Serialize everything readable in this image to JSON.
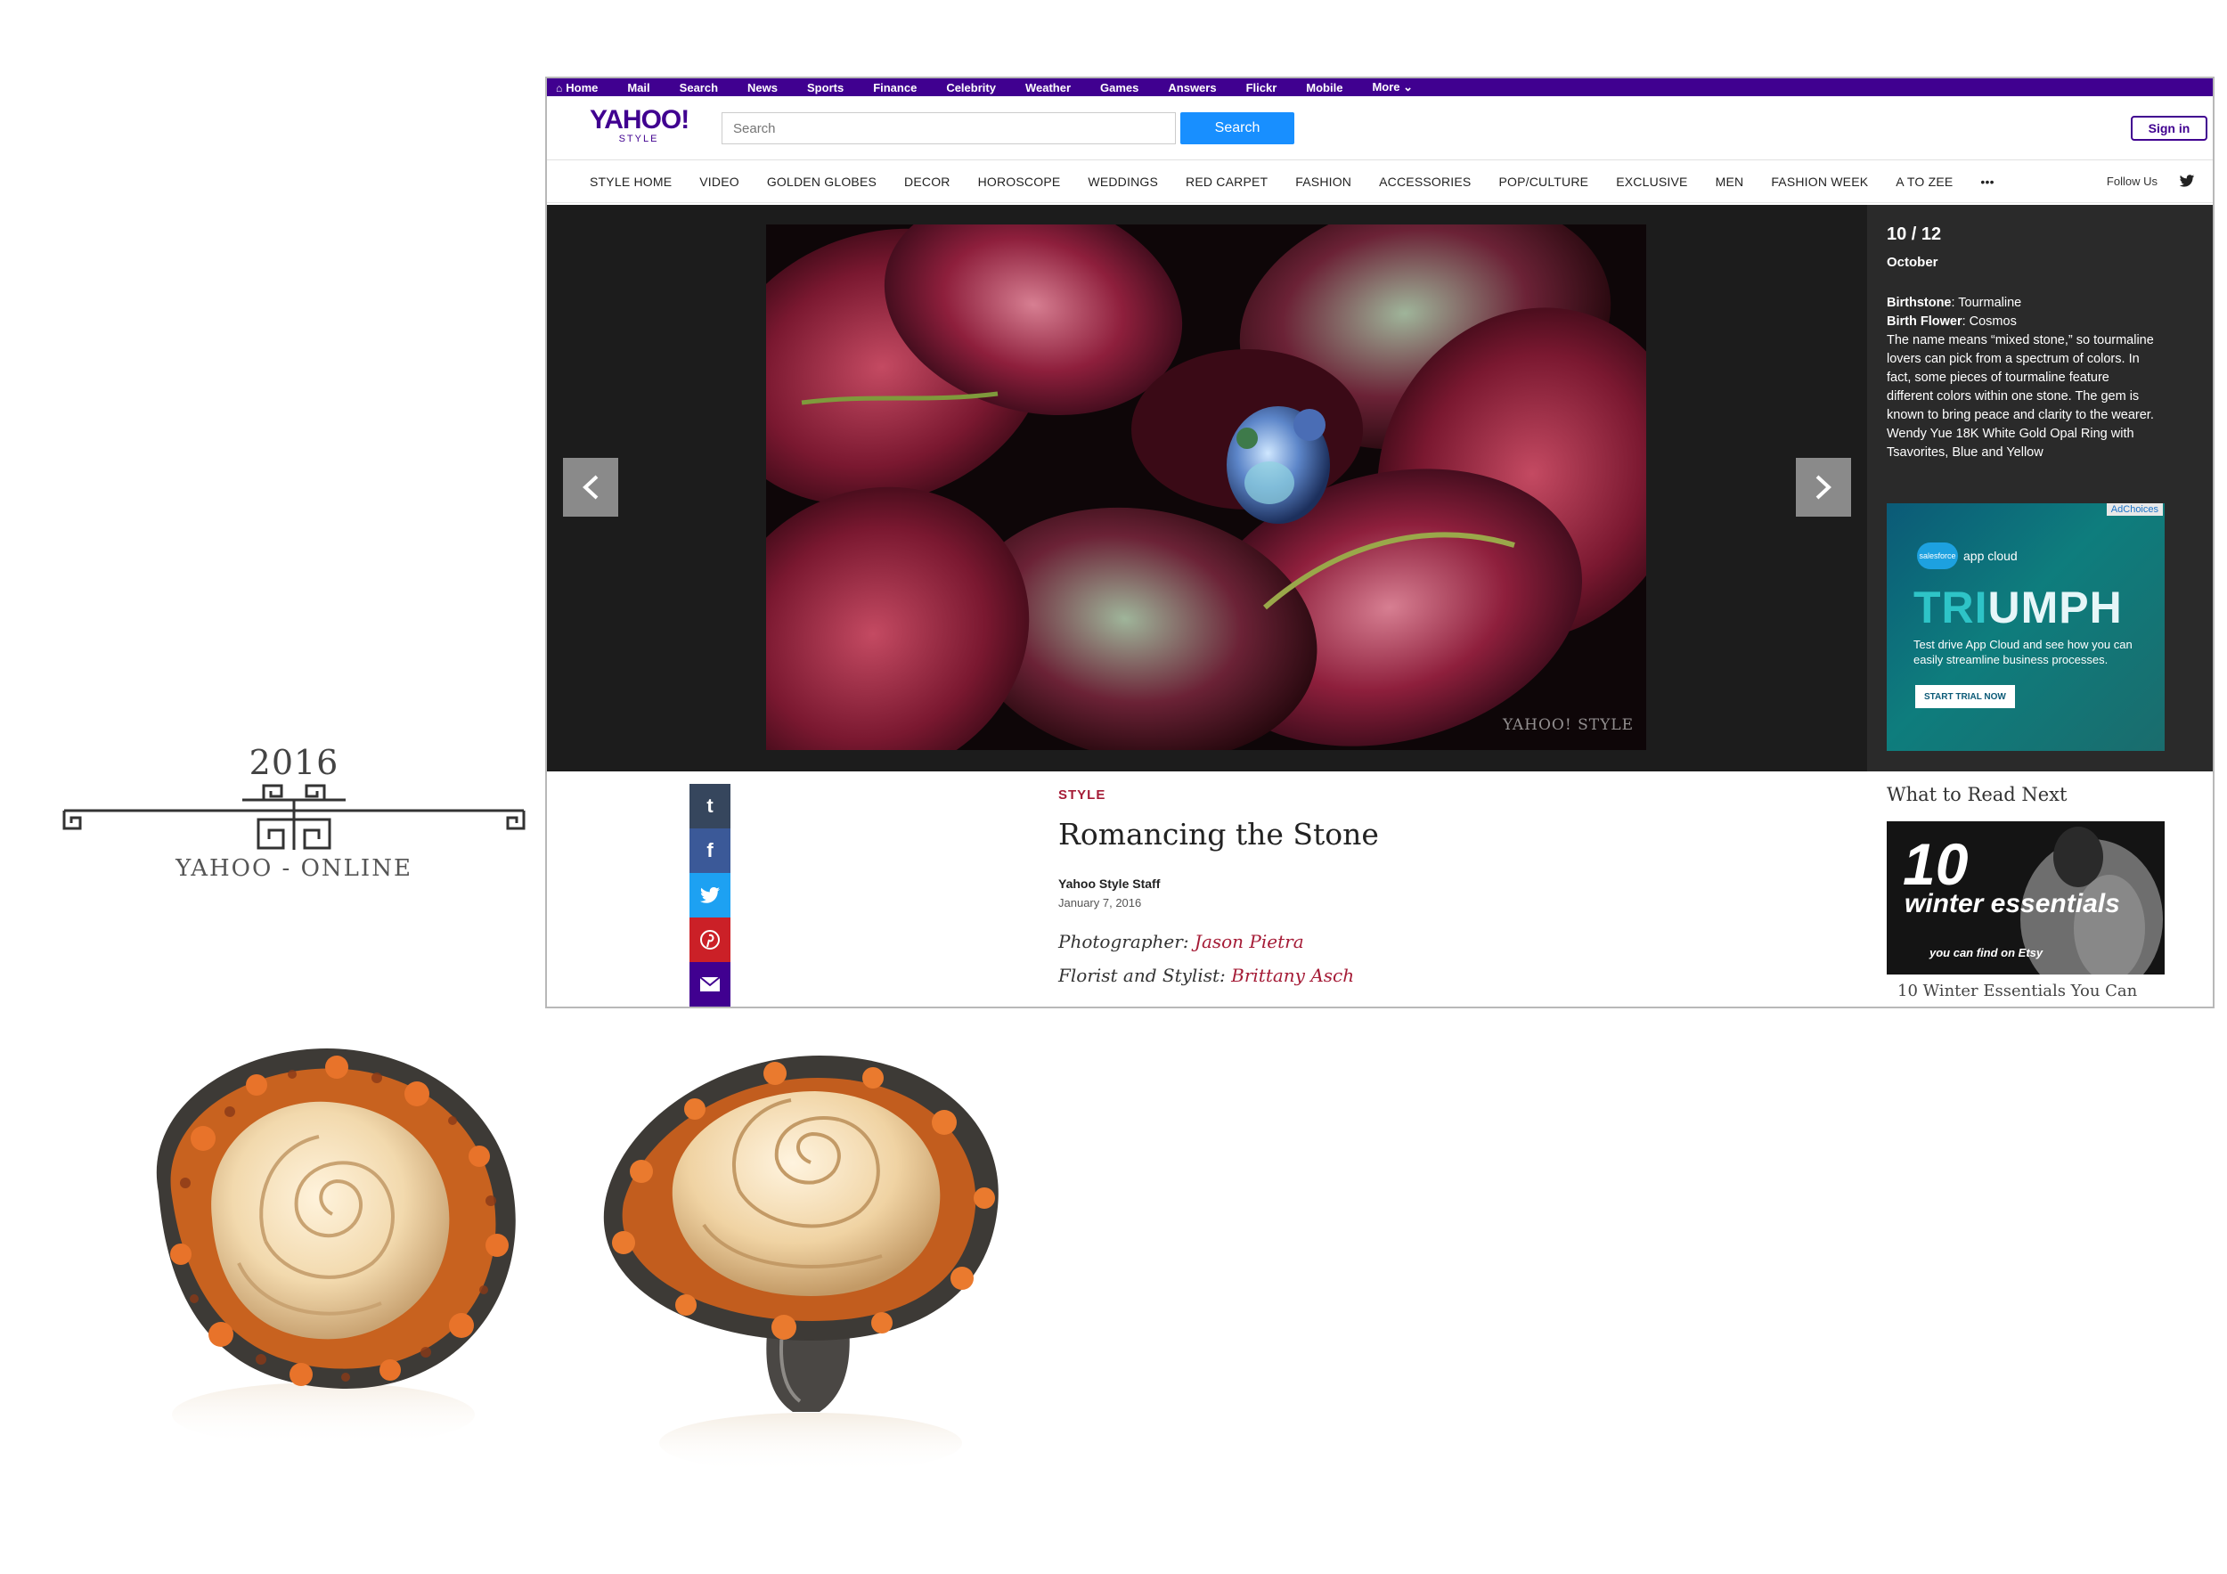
{
  "emblem": {
    "year": "2016",
    "caption": "YAHOO - ONLINE"
  },
  "topnav": {
    "items": [
      "Home",
      "Mail",
      "Search",
      "News",
      "Sports",
      "Finance",
      "Celebrity",
      "Weather",
      "Games",
      "Answers",
      "Flickr",
      "Mobile",
      "More"
    ]
  },
  "header": {
    "logo_main": "YAHOO!",
    "logo_sub": "STYLE",
    "search_placeholder": "Search",
    "search_button": "Search",
    "signin_button": "Sign in"
  },
  "stylenav": {
    "items": [
      "STYLE HOME",
      "VIDEO",
      "GOLDEN GLOBES",
      "DECOR",
      "HOROSCOPE",
      "WEDDINGS",
      "RED CARPET",
      "FASHION",
      "ACCESSORIES",
      "POP/CULTURE",
      "EXCLUSIVE",
      "MEN",
      "FASHION WEEK",
      "A TO ZEE",
      "•••"
    ],
    "follow_us": "Follow Us"
  },
  "slideshow": {
    "counter": "10 / 12",
    "month": "October",
    "birthstone_label": "Birthstone",
    "birthstone_value": ": Tourmaline",
    "birthflower_label": "Birth Flower",
    "birthflower_value": ": Cosmos",
    "description": "The name means “mixed stone,” so tourmaline lovers can pick from a spectrum of colors. In fact, some pieces of tourmaline feature different colors within one stone. The gem is known to bring peace and clarity to the wearer. Wendy Yue 18K White Gold Opal Ring with Tsavorites, Blue and Yellow",
    "watermark": "YAHOO! STYLE"
  },
  "ad": {
    "adchoices": "AdChoices",
    "brand_logo": "salesforce",
    "brand_product": "app cloud",
    "headline_part1": "TRI",
    "headline_part2": "UMPH",
    "body": "Test drive App Cloud and see how you can easily streamline business processes.",
    "cta": "START TRIAL NOW"
  },
  "share": {
    "tumblr": "t",
    "facebook": "f"
  },
  "article": {
    "section": "STYLE",
    "title": "Romancing the Stone",
    "author": "Yahoo Style Staff",
    "date": "January 7, 2016",
    "photographer_label": "Photographer:",
    "photographer_name": "Jason Pietra",
    "stylist_label": "Florist and Stylist:",
    "stylist_name": "Brittany Asch"
  },
  "read_next": {
    "title": "What to Read Next",
    "thumb_number": "10",
    "thumb_text": "winter essentials",
    "thumb_sub": "you can find on Etsy",
    "caption": "10 Winter Essentials You Can"
  },
  "colors": {
    "yahoo_purple": "#400090",
    "search_blue": "#188fff",
    "accent_red": "#a51b36",
    "slideshow_bg": "#1c1c1c"
  },
  "icons": [
    "home-icon",
    "chevron-down-icon",
    "twitter-icon",
    "chevron-left-icon",
    "chevron-right-icon",
    "tumblr-icon",
    "facebook-icon",
    "twitter-icon",
    "pinterest-icon",
    "mail-icon"
  ]
}
